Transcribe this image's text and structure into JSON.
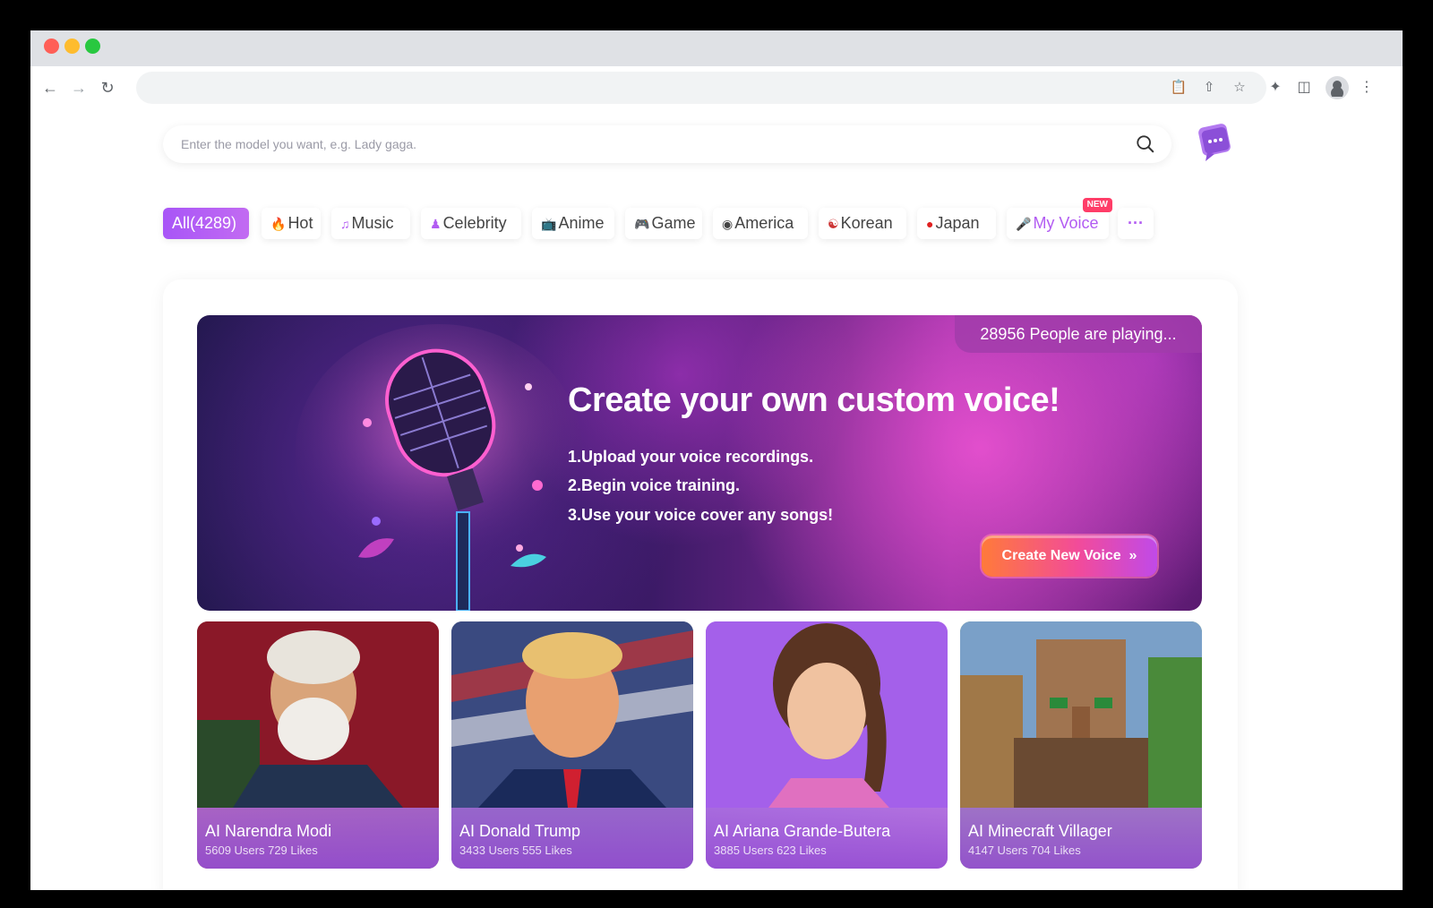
{
  "browser": {
    "address": ""
  },
  "search": {
    "placeholder": "Enter the model you want, e.g. Lady gaga."
  },
  "categories": [
    {
      "label": "All(4289)",
      "icon": "none"
    },
    {
      "label": "Hot",
      "icon": "flame-icon"
    },
    {
      "label": "Music",
      "icon": "music-note-icon"
    },
    {
      "label": "Celebrity",
      "icon": "person-icon"
    },
    {
      "label": "Anime",
      "icon": "tv-icon"
    },
    {
      "label": "Game",
      "icon": "gamepad-icon"
    },
    {
      "label": "America",
      "icon": "us-flag-icon"
    },
    {
      "label": "Korean",
      "icon": "korea-flag-icon"
    },
    {
      "label": "Japan",
      "icon": "japan-flag-icon"
    },
    {
      "label": "My Voice",
      "icon": "microphone-icon",
      "badge": "NEW"
    },
    {
      "label": "···",
      "icon": "more-icon"
    }
  ],
  "banner": {
    "playing": "28956 People are playing...",
    "title": "Create your own custom voice!",
    "steps": [
      "1.Upload your voice recordings.",
      "2.Begin voice training.",
      "3.Use your voice cover any songs!"
    ],
    "button": "Create New Voice"
  },
  "voices": [
    {
      "name": "AI Narendra Modi",
      "stats": "5609 Users 729 Likes"
    },
    {
      "name": "AI Donald Trump",
      "stats": "3433 Users 555 Likes"
    },
    {
      "name": "AI Ariana Grande-Butera",
      "stats": "3885 Users 623 Likes"
    },
    {
      "name": "AI Minecraft Villager",
      "stats": "4147 Users 704 Likes"
    }
  ],
  "colors": {
    "accent": "#a855f7",
    "badge": "#ff3d68",
    "button_start": "#ff7a3a",
    "button_end": "#c04ae8"
  }
}
